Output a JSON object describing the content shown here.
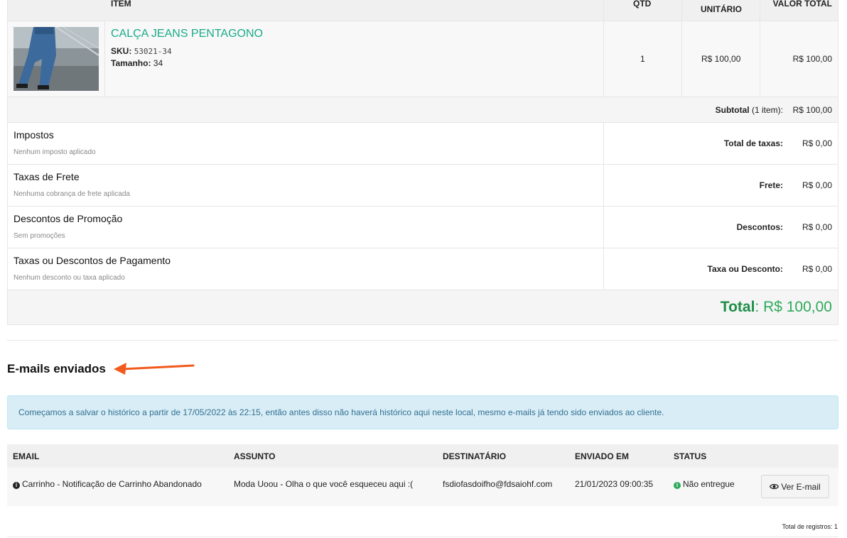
{
  "order": {
    "headers": {
      "item": "ITEM",
      "qty": "QTD",
      "unit": "UNITÁRIO",
      "total": "VALOR TOTAL"
    },
    "item": {
      "name": "CALÇA JEANS PENTAGONO",
      "sku_label": "SKU:",
      "sku": "53021-34",
      "size_label": "Tamanho:",
      "size": "34",
      "qty": "1",
      "unit_price": "R$ 100,00",
      "total_price": "R$ 100,00"
    },
    "subtotal": {
      "label": "Subtotal",
      "count": "(1 item):",
      "value": "R$ 100,00"
    },
    "fees": [
      {
        "title": "Impostos",
        "desc": "Nenhum imposto aplicado",
        "label": "Total de taxas",
        "value": "R$ 0,00"
      },
      {
        "title": "Taxas de Frete",
        "desc": "Nenhuma cobrança de frete aplicada",
        "label": "Frete",
        "value": "R$ 0,00"
      },
      {
        "title": "Descontos de Promoção",
        "desc": "Sem promoções",
        "label": "Descontos",
        "value": "R$ 0,00"
      },
      {
        "title": "Taxas ou Descontos de Pagamento",
        "desc": "Nenhum desconto ou taxa aplicado",
        "label": "Taxa ou Desconto",
        "value": "R$ 0,00"
      }
    ],
    "total": {
      "label": "Total",
      "value": "R$ 100,00"
    }
  },
  "emails": {
    "title": "E-mails enviados",
    "alert": "Começamos a salvar o histórico a partir de 17/05/2022 às 22:15, então antes disso não haverá histórico aqui neste local, mesmo e-mails já tendo sido enviados ao cliente.",
    "headers": {
      "email": "EMAIL",
      "subject": "ASSUNTO",
      "recipient": "DESTINATÁRIO",
      "sent": "ENVIADO EM",
      "status": "STATUS"
    },
    "rows": [
      {
        "email": "Carrinho - Notificação de Carrinho Abandonado",
        "subject": "Moda Uoou - Olha o que você esqueceu aqui :(",
        "recipient": "fsdiofasdoifho@fdsaiohf.com",
        "sent": "21/01/2023 09:00:35",
        "status": "Não entregue",
        "button": "Ver E-mail"
      }
    ],
    "records": "Total de registros: 1"
  },
  "colors": {
    "product_link": "#1aab8a",
    "total_green": "#2eaa5a",
    "alert_bg": "#d9edf7",
    "alert_text": "#31708f",
    "arrow": "#f05a1c"
  },
  "icons": {
    "info": "info-circle-icon",
    "status": "info-circle-green-icon",
    "button": "eye-icon",
    "annotation": "orange-arrow-icon"
  }
}
